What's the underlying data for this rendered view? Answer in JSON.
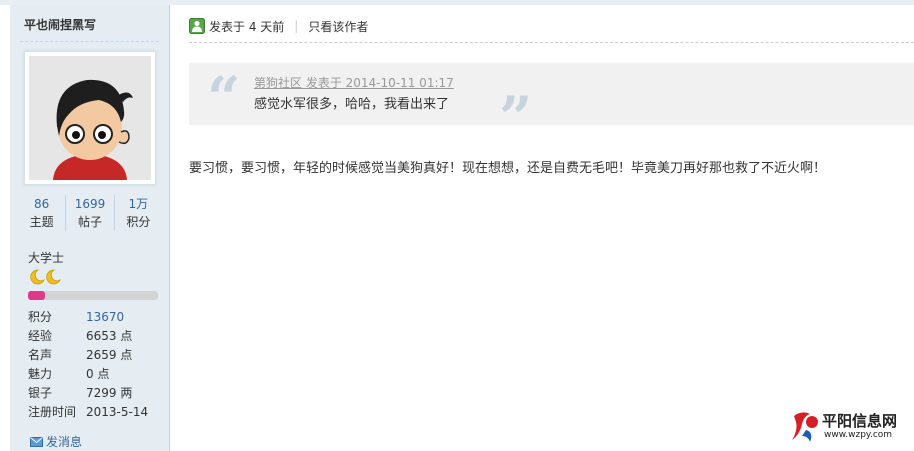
{
  "author": {
    "name": "平也闹捏黑写"
  },
  "stats": [
    {
      "value": "86",
      "label": "主题"
    },
    {
      "value": "1699",
      "label": "帖子"
    },
    {
      "value": "1万",
      "label": "积分"
    }
  ],
  "rank": {
    "title": "大学士",
    "progress": 0.13,
    "bar_color": "#e2388c"
  },
  "info": [
    {
      "key": "积分",
      "value": "13670"
    },
    {
      "key": "经验",
      "value": "6653 点"
    },
    {
      "key": "名声",
      "value": "2659 点"
    },
    {
      "key": "魅力",
      "value": "0 点"
    },
    {
      "key": "银子",
      "value": "7299 两"
    },
    {
      "key": "注册时间",
      "value": "2013-5-14"
    }
  ],
  "send_message": "发消息",
  "post": {
    "time": "发表于 4 天前",
    "only_author": "只看该作者",
    "quote_meta": "第狗社区 发表于 2014-10-11 01:17",
    "quote_text": "感觉水军很多，哈哈，我看出来了",
    "body": "要习惯，要习惯，年轻的时候感觉当美狗真好！现在想想，还是自费无毛吧！毕竟美刀再好那也救了不近火啊！"
  },
  "watermark": {
    "name": "平阳信息网",
    "url": "www.wzpy.com"
  },
  "colors": {
    "link": "#336699",
    "sidebar_bg": "#e5edf2"
  }
}
